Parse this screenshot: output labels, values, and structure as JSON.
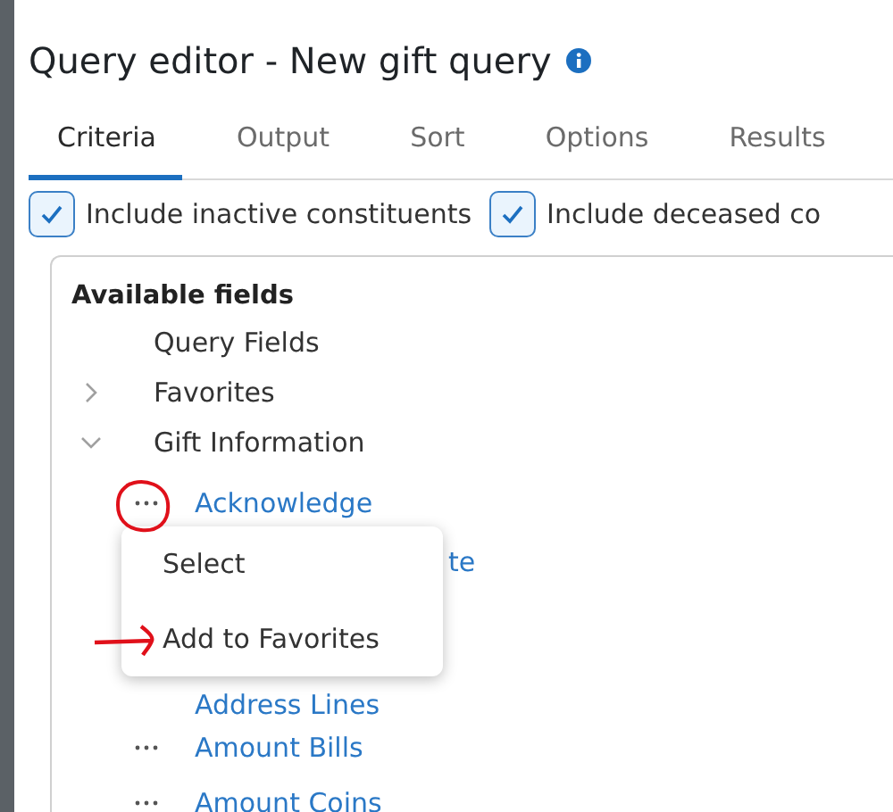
{
  "window": {
    "title": "Query editor - New gift query"
  },
  "tabs": [
    {
      "label": "Criteria",
      "selected": true
    },
    {
      "label": "Output",
      "selected": false
    },
    {
      "label": "Sort",
      "selected": false
    },
    {
      "label": "Options",
      "selected": false
    },
    {
      "label": "Results",
      "selected": false
    }
  ],
  "options": [
    {
      "label": "Include inactive constituents",
      "checked": true
    },
    {
      "label": "Include deceased co",
      "checked": true
    }
  ],
  "available_fields": {
    "heading": "Available fields",
    "items": [
      {
        "label": "Query Fields",
        "kind": "leaf"
      },
      {
        "label": "Favorites",
        "kind": "folder",
        "expanded": false
      },
      {
        "label": "Gift Information",
        "kind": "folder",
        "expanded": true,
        "children": [
          {
            "label": "Acknowledge",
            "kind": "field",
            "menu_button": true
          },
          {
            "label": "te",
            "kind": "field",
            "menu_button": false
          },
          {
            "label": "Address Lines",
            "kind": "field",
            "menu_button": false
          },
          {
            "label": "Amount Bills",
            "kind": "field",
            "menu_button": true
          },
          {
            "label": "Amount Coins",
            "kind": "field",
            "menu_button": true
          }
        ]
      }
    ]
  },
  "context_menu": {
    "items": [
      {
        "label": "Select"
      },
      {
        "label": "Add to Favorites"
      }
    ]
  },
  "markup": {
    "circle": true,
    "arrow": true
  }
}
